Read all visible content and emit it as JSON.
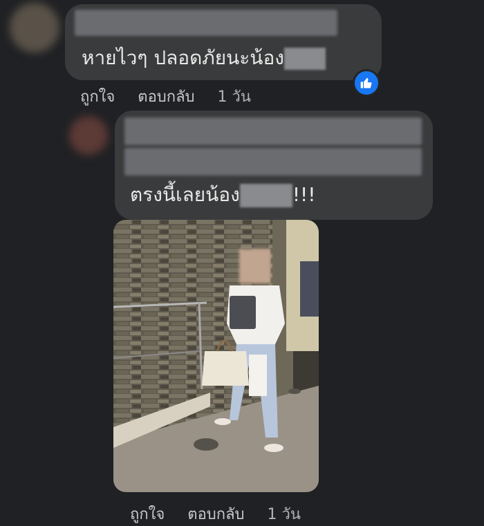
{
  "comments": [
    {
      "text": "หายไวๆ ปลอดภัยนะน้อง",
      "actions": {
        "like": "ถูกใจ",
        "reply": "ตอบกลับ",
        "time": "1 วัน"
      },
      "reaction_icon": "thumbs-up-icon"
    },
    {
      "text": "ตรงนี้เลยน้อง",
      "suffix": "!!!",
      "actions": {
        "like": "ถูกใจ",
        "reply": "ตอบกลับ",
        "time": "1 วัน"
      }
    }
  ],
  "colors": {
    "background": "#202124",
    "bubble": "#3a3b3c",
    "like_blue": "#1877f2",
    "text": "#e8e8e8",
    "muted": "#c8c9cc"
  }
}
